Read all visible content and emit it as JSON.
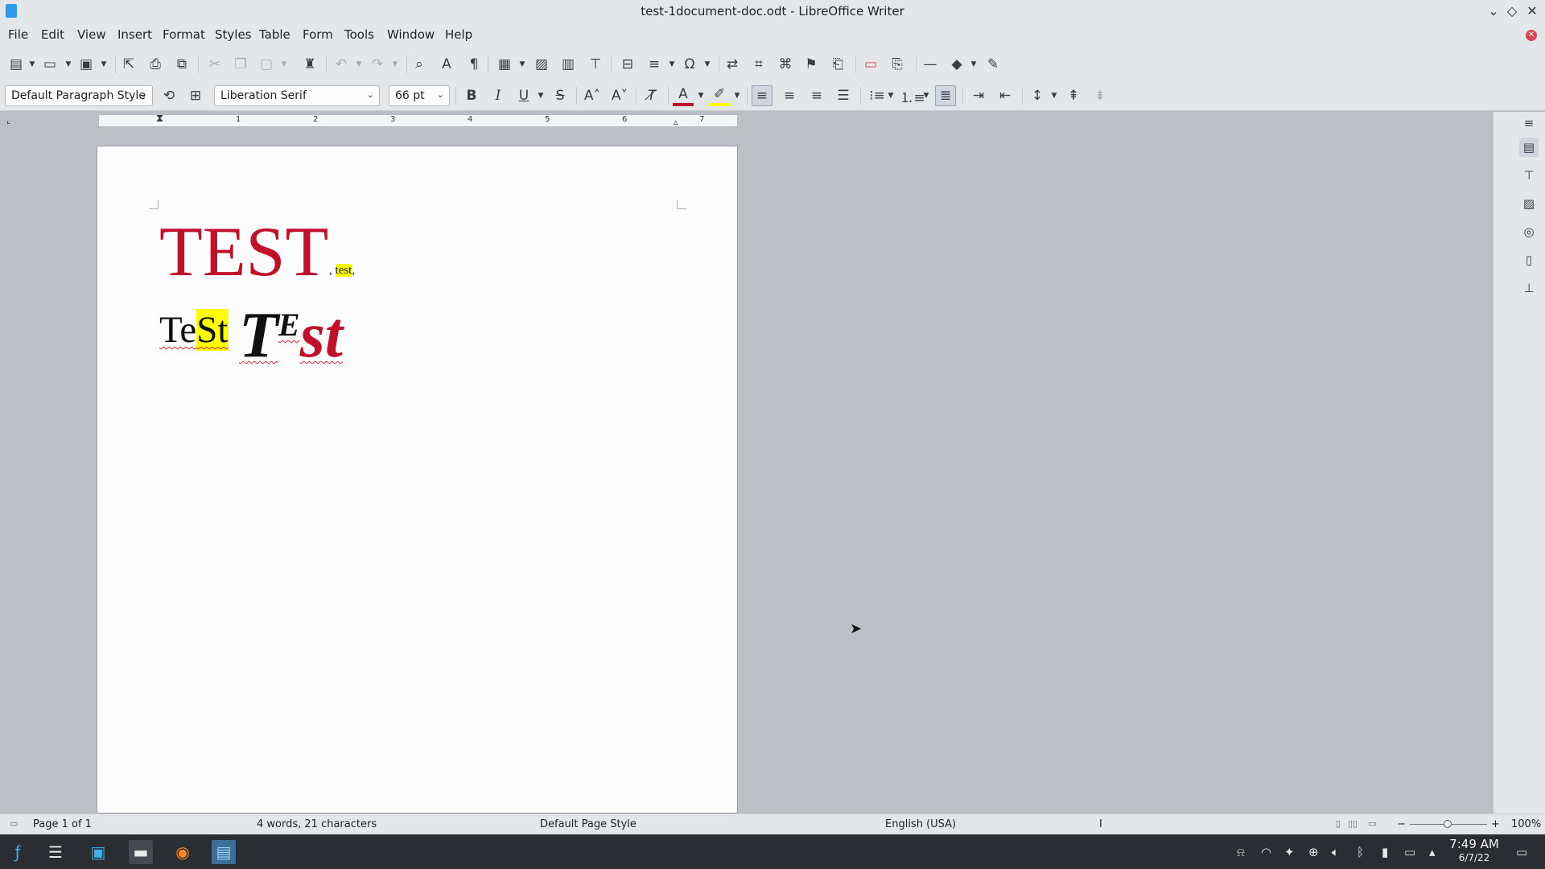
{
  "window": {
    "title": "test-1document-doc.odt - LibreOffice Writer",
    "controls": {
      "minimize": "⌄",
      "maximize": "◇",
      "close": "✕"
    }
  },
  "menu": [
    "File",
    "Edit",
    "View",
    "Insert",
    "Format",
    "Styles",
    "Table",
    "Form",
    "Tools",
    "Window",
    "Help"
  ],
  "toolbar": {
    "paragraph_style": "Default Paragraph Style",
    "font_name": "Liberation Serif",
    "font_size": "66 pt",
    "bold": "B",
    "italic": "I",
    "underline": "U",
    "strike": "S"
  },
  "ruler": {
    "numbers": [
      "1",
      "2",
      "3",
      "4",
      "5",
      "6",
      "7"
    ]
  },
  "document": {
    "line1_big": "TEST",
    "line1_sep1": ",",
    "line1_small": "test",
    "line1_sep2": ",",
    "line2_te": "Te",
    "line2_st": "St",
    "line2_T": "T",
    "line2_E": "E",
    "line2_st2": "st"
  },
  "status": {
    "page": "Page 1 of 1",
    "words": "4 words, 21 characters",
    "page_style": "Default Page Style",
    "language": "English (USA)",
    "cursor_mode": "I",
    "zoom": "100%"
  },
  "taskbar": {
    "time": "7:49 AM",
    "date": "6/7/22"
  },
  "colors": {
    "accent_red": "#c0102a",
    "highlight": "#ffff00",
    "taskbar": "#2a2e33"
  }
}
